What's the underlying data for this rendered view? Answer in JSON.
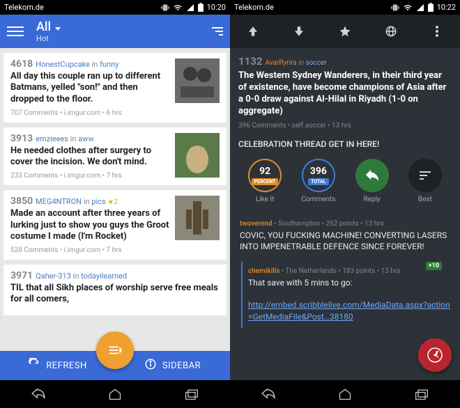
{
  "left": {
    "status": {
      "carrier": "Telekom.de",
      "time": "10:20"
    },
    "header": {
      "title": "All",
      "subtitle": "Hot"
    },
    "posts": [
      {
        "score": "4618",
        "user": "HonestCupcake",
        "in": "in",
        "sub": "funny",
        "title": "All day this couple ran up to different Batmans, yelled \"son!\" and then dropped to the floor.",
        "meta": "707 Comments • i.imgur.com • 6 hrs"
      },
      {
        "score": "3913",
        "user": "emzieees",
        "in": "in",
        "sub": "aww",
        "title": "He needed clothes after surgery to cover the incision. We don't mind.",
        "meta": "233 Comments • i.imgur.com • 7 hrs"
      },
      {
        "score": "3850",
        "user": "MEG4NTRON",
        "in": "in",
        "sub": "pics",
        "gold": "★2",
        "title": "Made an account after three years of lurking just to show you guys the Groot costume I made (I'm Rocket)",
        "meta": "528 Comments • i.imgur.com • 7 hrs"
      },
      {
        "score": "3971",
        "user": "Qaher-313",
        "in": "in",
        "sub": "todayilearned",
        "title": "TIL that all Sikh places of worship serve free meals for all comers,",
        "meta": ""
      }
    ],
    "bottom": {
      "refresh": "REFRESH",
      "sidebar": "SIDEBAR"
    }
  },
  "right": {
    "status": {
      "carrier": "Telekom.de",
      "time": "10:22"
    },
    "post": {
      "score": "1132",
      "user": "AvarRyrira",
      "in": "in",
      "sub": "soccer",
      "title": "The Western Sydney Wanderers, in their third year of existence, have become champions of Asia after a 0-0 draw against Al-Hilal in Riyadh (1-0 on aggregate)",
      "meta": "396 Comments • self.soccer • 13 hrs",
      "body": "CELEBRATION THREAD GET IN HERE!"
    },
    "actions": {
      "likeit": {
        "value": "92",
        "badge": "PERCENT",
        "label": "Like It"
      },
      "comments": {
        "value": "396",
        "badge": "TOTAL",
        "label": "Comments"
      },
      "reply": {
        "label": "Reply"
      },
      "best": {
        "label": "Best"
      }
    },
    "comments": [
      {
        "user": "twoverend",
        "flair": "Southampton",
        "points": "262 points",
        "age": "13 hrs",
        "body": "COVIC, YOU FUCKING MACHINE! CONVERTING LASERS INTO IMPENETRABLE DEFENCE SINCE FOREVER!"
      },
      {
        "user": "chemikills",
        "flair": "The Netherlands",
        "points": "183 points",
        "age": "13 hrs",
        "pill": "+10",
        "body_pre": "That save with 5 mins to go:",
        "link": "http://embed.scribblelive.com/MediaData.aspx?action=GetMediaFile&Post…38180"
      }
    ]
  }
}
